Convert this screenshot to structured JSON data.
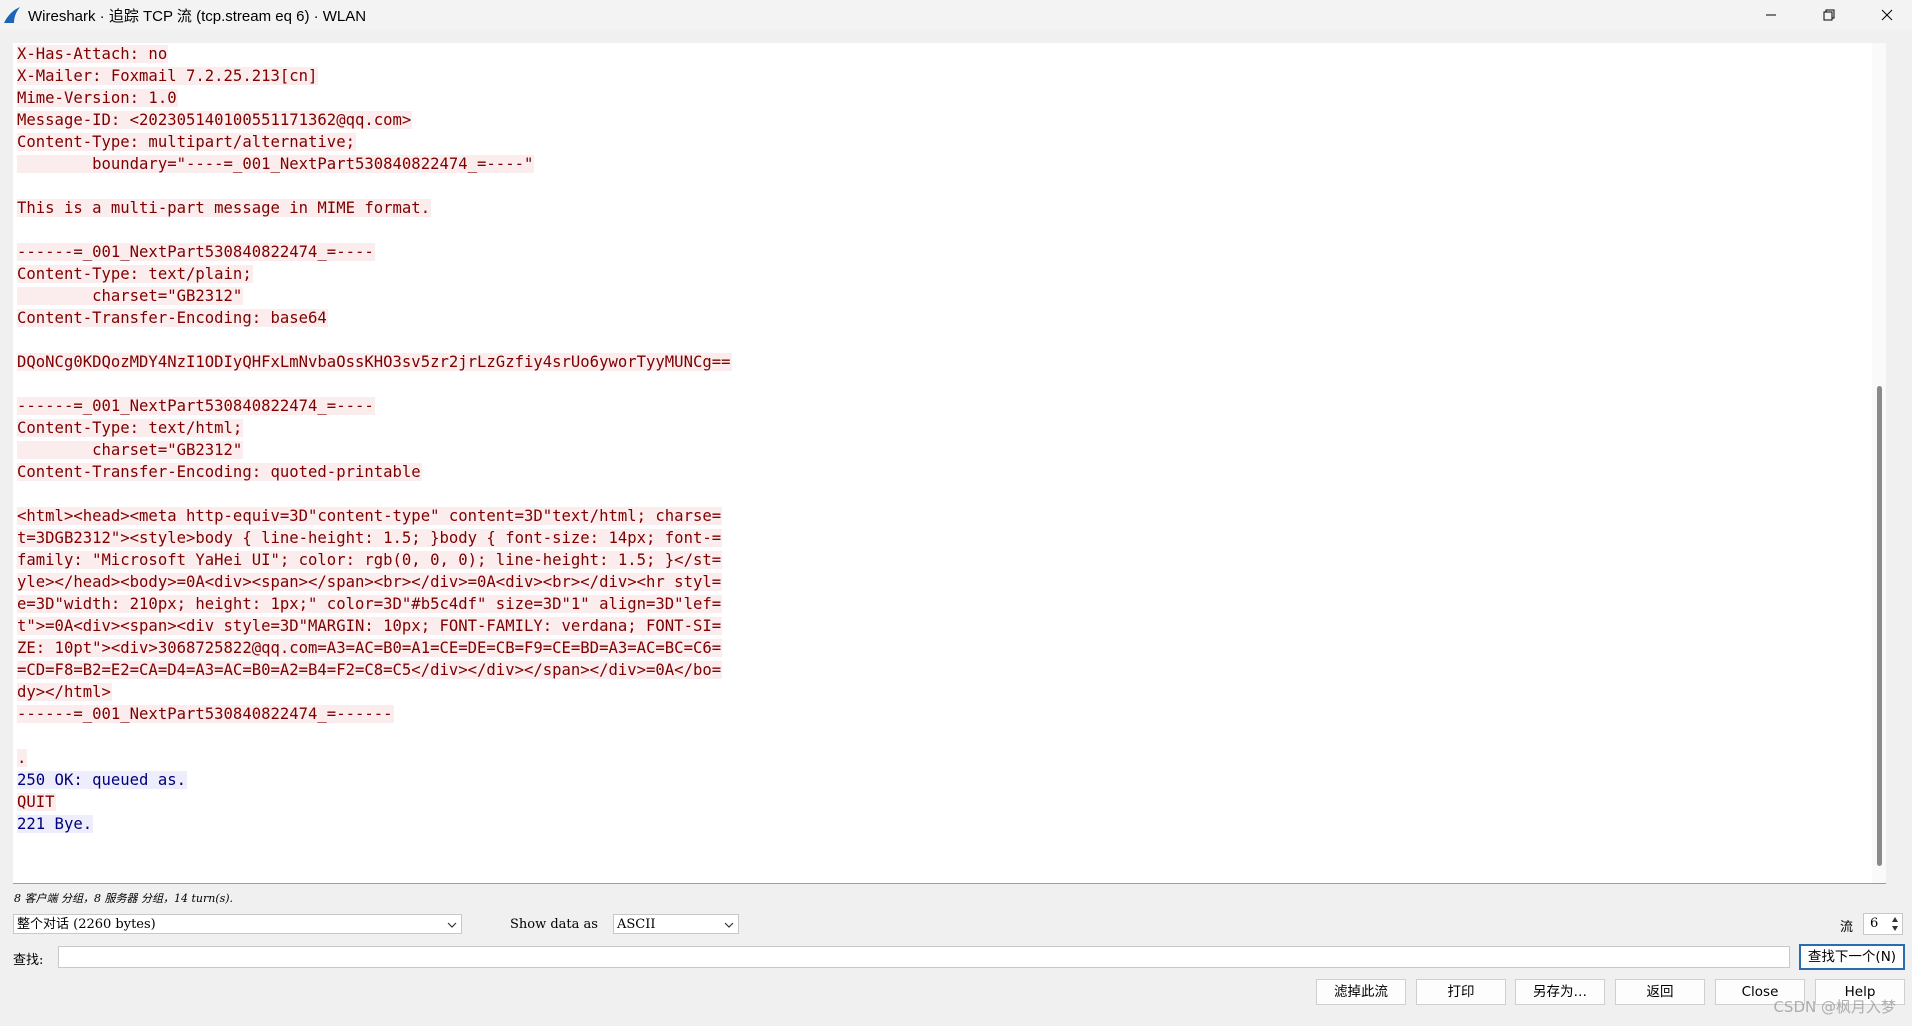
{
  "window": {
    "title": "Wireshark · 追踪 TCP 流 (tcp.stream eq 6) · WLAN"
  },
  "stream_lines": [
    {
      "dir": "c",
      "text": "X-Has-Attach: no"
    },
    {
      "dir": "c",
      "text": "X-Mailer: Foxmail 7.2.25.213[cn]"
    },
    {
      "dir": "c",
      "text": "Mime-Version: 1.0"
    },
    {
      "dir": "c",
      "text": "Message-ID: <202305140100551171362@qq.com>"
    },
    {
      "dir": "c",
      "text": "Content-Type: multipart/alternative;"
    },
    {
      "dir": "c",
      "text": "        boundary=\"----=_001_NextPart530840822474_=----\""
    },
    {
      "dir": "c",
      "text": ""
    },
    {
      "dir": "c",
      "text": "This is a multi-part message in MIME format."
    },
    {
      "dir": "c",
      "text": ""
    },
    {
      "dir": "c",
      "text": "------=_001_NextPart530840822474_=----"
    },
    {
      "dir": "c",
      "text": "Content-Type: text/plain;"
    },
    {
      "dir": "c",
      "text": "        charset=\"GB2312\""
    },
    {
      "dir": "c",
      "text": "Content-Transfer-Encoding: base64"
    },
    {
      "dir": "c",
      "text": ""
    },
    {
      "dir": "c",
      "text": "DQoNCg0KDQozMDY4NzI1ODIyQHFxLmNvbaOssKHO3sv5zr2jrLzGzfiy4srUo6yworTyyMUNCg=="
    },
    {
      "dir": "c",
      "text": ""
    },
    {
      "dir": "c",
      "text": "------=_001_NextPart530840822474_=----"
    },
    {
      "dir": "c",
      "text": "Content-Type: text/html;"
    },
    {
      "dir": "c",
      "text": "        charset=\"GB2312\""
    },
    {
      "dir": "c",
      "text": "Content-Transfer-Encoding: quoted-printable"
    },
    {
      "dir": "c",
      "text": ""
    },
    {
      "dir": "c",
      "text": "<html><head><meta http-equiv=3D\"content-type\" content=3D\"text/html; charse="
    },
    {
      "dir": "c",
      "text": "t=3DGB2312\"><style>body { line-height: 1.5; }body { font-size: 14px; font-="
    },
    {
      "dir": "c",
      "text": "family: \"Microsoft YaHei UI\"; color: rgb(0, 0, 0); line-height: 1.5; }</st="
    },
    {
      "dir": "c",
      "text": "yle></head><body>=0A<div><span></span><br></div>=0A<div><br></div><hr styl="
    },
    {
      "dir": "c",
      "text": "e=3D\"width: 210px; height: 1px;\" color=3D\"#b5c4df\" size=3D\"1\" align=3D\"lef="
    },
    {
      "dir": "c",
      "text": "t\">=0A<div><span><div style=3D\"MARGIN: 10px; FONT-FAMILY: verdana; FONT-SI="
    },
    {
      "dir": "c",
      "text": "ZE: 10pt\"><div>3068725822@qq.com=A3=AC=B0=A1=CE=DE=CB=F9=CE=BD=A3=AC=BC=C6="
    },
    {
      "dir": "c",
      "text": "=CD=F8=B2=E2=CA=D4=A3=AC=B0=A2=B4=F2=C8=C5</div></div></span></div>=0A</bo="
    },
    {
      "dir": "c",
      "text": "dy></html>"
    },
    {
      "dir": "c",
      "text": "------=_001_NextPart530840822474_=------"
    },
    {
      "dir": "c",
      "text": ""
    },
    {
      "dir": "c",
      "text": "."
    },
    {
      "dir": "s",
      "text": "250 OK: queued as."
    },
    {
      "dir": "c",
      "text": "QUIT"
    },
    {
      "dir": "s",
      "text": "221 Bye."
    }
  ],
  "info_line": "8 客户端 分组，8 服务器 分组，14 turn(s).",
  "conversation_select": {
    "value": "整个对话 (2260 bytes)"
  },
  "show_data_label": "Show data as",
  "show_data_select": {
    "value": "ASCII"
  },
  "stream_label": "流",
  "stream_number": "6",
  "find_label": "查找:",
  "find_input": {
    "value": ""
  },
  "buttons": {
    "find_next": "查找下一个(N)",
    "filter_out": "滤掉此流",
    "print": "打印",
    "save_as": "另存为…",
    "back": "返回",
    "close": "Close",
    "help": "Help"
  },
  "watermark": "CSDN @枫月入梦",
  "colors": {
    "client_bg": "#fbeded",
    "client_fg": "#7f0000",
    "server_bg": "#ededfb",
    "server_fg": "#00007f"
  }
}
